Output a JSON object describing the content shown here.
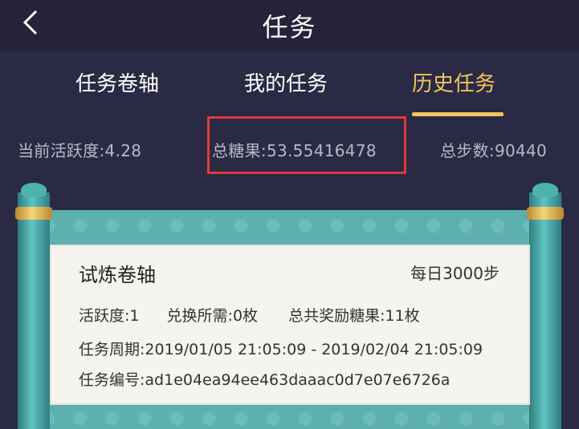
{
  "header": {
    "title": "任务"
  },
  "tabs": [
    {
      "label": "任务卷轴",
      "active": false
    },
    {
      "label": "我的任务",
      "active": false
    },
    {
      "label": "历史任务",
      "active": true
    }
  ],
  "stats": {
    "activity": "当前活跃度:4.28",
    "candy": "总糖果:53.55416478",
    "steps": "总步数:90440"
  },
  "card": {
    "title": "试炼卷轴",
    "daily_steps": "每日3000步",
    "activity": "活跃度:1",
    "exchange": "兑换所需:0枚",
    "reward": "总共奖励糖果:11枚",
    "period": "任务周期:2019/01/05 21:05:09 - 2019/02/04 21:05:09",
    "task_id": "任务编号:ad1e04ea94ee463daaac0d7e07e6726a"
  },
  "colors": {
    "background": "#2b2a45",
    "accent": "#f1c45c",
    "highlight": "#e03b3b",
    "scroll": "#5cb0ad"
  }
}
